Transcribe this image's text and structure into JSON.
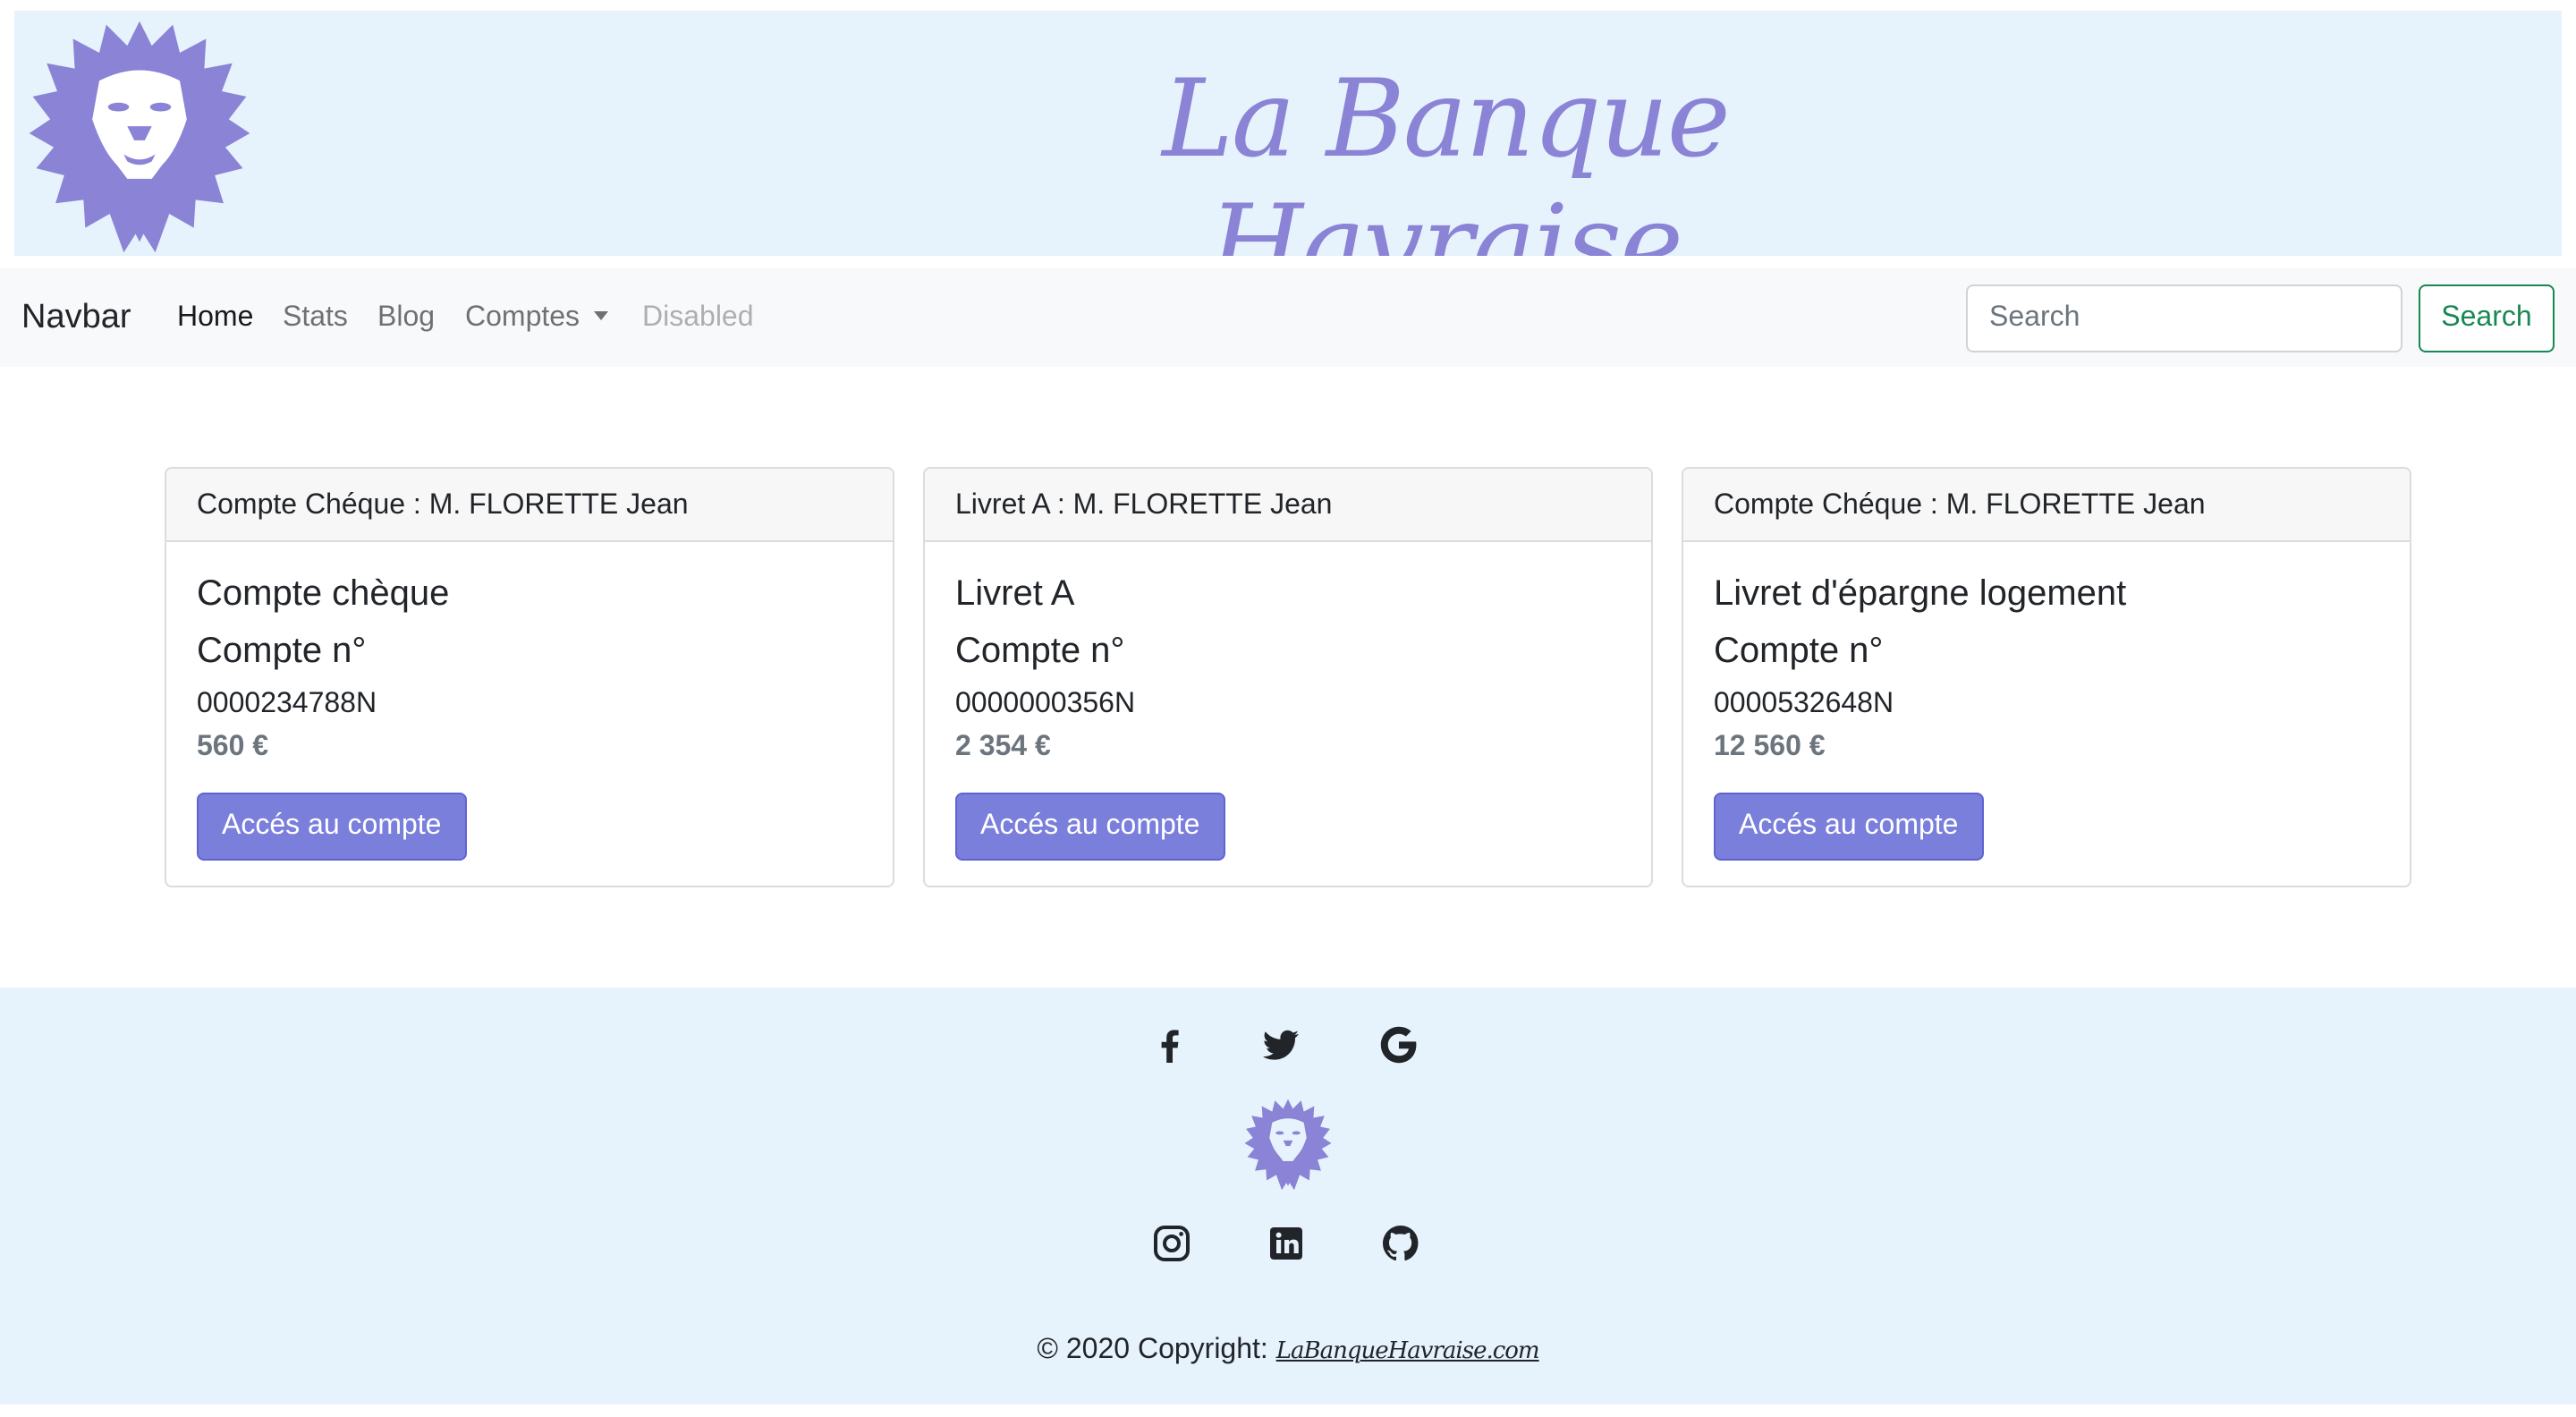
{
  "colors": {
    "accent": "#7b7fdc",
    "logo": "#8a83d6",
    "banner_bg": "#e6f2fc",
    "search_green": "#198754"
  },
  "banner": {
    "brand_text": "La Banque Havraise",
    "logo_icon": "lion-head-icon"
  },
  "navbar": {
    "brand": "Navbar",
    "links": [
      {
        "label": "Home",
        "state": "active"
      },
      {
        "label": "Stats",
        "state": "normal"
      },
      {
        "label": "Blog",
        "state": "normal"
      },
      {
        "label": "Comptes",
        "state": "dropdown"
      },
      {
        "label": "Disabled",
        "state": "disabled"
      }
    ],
    "search_placeholder": "Search",
    "search_button": "Search"
  },
  "cards": [
    {
      "header": "Compte Chéque : M. FLORETTE Jean",
      "title": "Compte chèque",
      "subtitle": "Compte n°",
      "number": "0000234788N",
      "amount": "560 €",
      "button": "Accés au compte"
    },
    {
      "header": "Livret A : M. FLORETTE Jean",
      "title": "Livret A",
      "subtitle": "Compte n°",
      "number": "0000000356N",
      "amount": "2 354 €",
      "button": "Accés au compte"
    },
    {
      "header": "Compte Chéque : M. FLORETTE Jean",
      "title": "Livret d'épargne logement",
      "subtitle": "Compte n°",
      "number": "0000532648N",
      "amount": "12 560 €",
      "button": "Accés au compte"
    }
  ],
  "footer": {
    "social_top": [
      "facebook-icon",
      "twitter-icon",
      "google-icon"
    ],
    "social_bottom": [
      "instagram-icon",
      "linkedin-icon",
      "github-icon"
    ],
    "copyright_prefix": "© 2020 Copyright:",
    "copyright_link": "LaBanqueHavraise.com"
  }
}
